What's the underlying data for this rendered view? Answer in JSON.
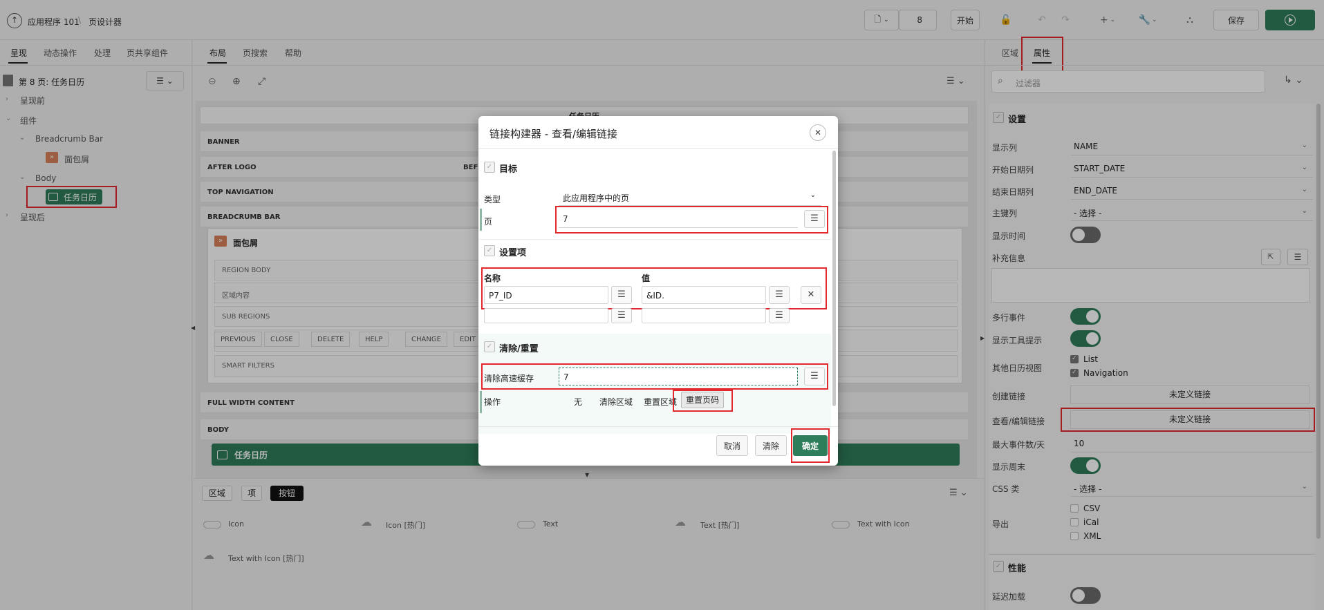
{
  "topbar": {
    "app_name": "应用程序 101",
    "separator": "\\",
    "page_designer": "页设计器",
    "page_number": "8",
    "go_label": "开始",
    "save_label": "保存",
    "plus_label": "+"
  },
  "left": {
    "tabs": [
      "呈现",
      "动态操作",
      "处理",
      "页共享组件"
    ],
    "page_title": "第 8 页: 任务日历",
    "tree": {
      "pre_render": "呈现前",
      "components": "组件",
      "breadcrumb_bar": "Breadcrumb Bar",
      "breadcrumb": "面包屑",
      "body": "Body",
      "task_calendar": "任务日历",
      "post_render": "呈现后"
    }
  },
  "center": {
    "tabs": [
      "布局",
      "页搜索",
      "帮助"
    ],
    "layout": {
      "header_title": "任务日历",
      "banner": "BANNER",
      "after_logo": "AFTER LOGO",
      "before_partial": "BEFO",
      "top_navigation": "TOP NAVIGATION",
      "breadcrumb_bar": "BREADCRUMB BAR",
      "breadcrumb_region": "面包屑",
      "region_body": "REGION BODY",
      "region_content": "区域内容",
      "sub_regions": "SUB REGIONS",
      "buttons": [
        "PREVIOUS",
        "CLOSE",
        "DELETE",
        "HELP",
        "CHANGE",
        "EDIT"
      ],
      "smart_filters": "SMART FILTERS",
      "full_width_content": "FULL WIDTH CONTENT",
      "body": "BODY",
      "body_region": "任务日历"
    },
    "gallery": {
      "tabs": [
        "区域",
        "项",
        "按钮"
      ],
      "items": [
        "Icon",
        "Icon [热门]",
        "Text",
        "Text [热门]",
        "Text with Icon",
        "Text with Icon [热门]"
      ]
    }
  },
  "right": {
    "tabs": [
      "区域",
      "属性"
    ],
    "filter_placeholder": "过滤器",
    "settings_header": "设置",
    "props": {
      "display_column": {
        "label": "显示列",
        "value": "NAME"
      },
      "start_date_column": {
        "label": "开始日期列",
        "value": "START_DATE"
      },
      "end_date_column": {
        "label": "结束日期列",
        "value": "END_DATE"
      },
      "primary_key_column": {
        "label": "主键列",
        "value": "- 选择 -"
      },
      "show_time": {
        "label": "显示时间"
      },
      "supplemental_info": {
        "label": "补充信息"
      },
      "multi_day_events": {
        "label": "多行事件"
      },
      "show_tooltip": {
        "label": "显示工具提示"
      },
      "other_views": {
        "label": "其他日历视图",
        "options": [
          "List",
          "Navigation"
        ]
      },
      "create_link": {
        "label": "创建链接",
        "value": "未定义链接"
      },
      "view_edit_link": {
        "label": "查看/编辑链接",
        "value": "未定义链接"
      },
      "max_events": {
        "label": "最大事件数/天",
        "value": "10"
      },
      "show_weekend": {
        "label": "显示周末"
      },
      "css_classes": {
        "label": "CSS 类",
        "value": "- 选择 -"
      },
      "export": {
        "label": "导出",
        "options": [
          "CSV",
          "iCal",
          "XML"
        ]
      }
    },
    "performance_header": "性能",
    "lazy_loading": "延迟加载"
  },
  "dialog": {
    "title": "链接构建器 - 查看/编辑链接",
    "target_header": "目标",
    "type_label": "类型",
    "type_value": "此应用程序中的页",
    "page_label": "页",
    "page_value": "7",
    "set_items_header": "设置项",
    "name_col": "名称",
    "value_col": "值",
    "item_name": "P7_ID",
    "item_value": "&ID.",
    "clear_header": "清除/重置",
    "clear_cache_label": "清除高速缓存",
    "clear_cache_value": "7",
    "action_label": "操作",
    "action_options": [
      "无",
      "清除区域",
      "重置区域",
      "重置页码"
    ],
    "cancel": "取消",
    "clear": "清除",
    "ok": "确定"
  },
  "colors": {
    "accent_green": "#2e7d5b",
    "highlight_red": "#e3282d",
    "breadcrumb_orange": "#d9825b"
  }
}
